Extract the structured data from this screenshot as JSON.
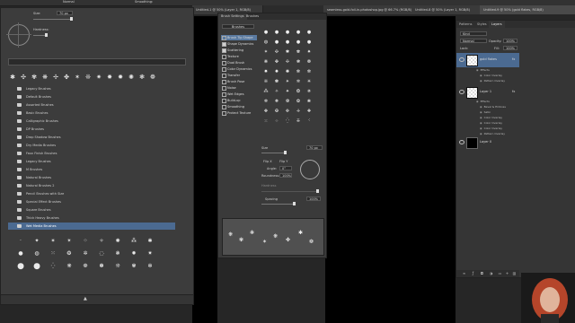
{
  "top_bar": {
    "mode_label": "Normal",
    "snapshot_label": "Smoothing:"
  },
  "document_tabs": [
    "Untitled-1 @ 50% (Layer 1, RGB/8)",
    "seamless-gold-foil-in-photoshop.jpg @ 66.7% (RGB/8)",
    "Untitled-8 @ 50% (Layer 1, RGB/8)",
    "Untitled-9 @ 50% (gold flakes, RGB/8)"
  ],
  "brush_preset_panel": {
    "size_label": "Size:",
    "size_value": "70 px",
    "hardness_label": "Hardness:",
    "folders": [
      "Legacy Brushes",
      "Default Brushes",
      "Assorted Brushes",
      "Basic Brushes",
      "Calligraphic Brushes",
      "DP Brushes",
      "Drop Shadow Brushes",
      "Dry Media Brushes",
      "Faux Finish Brushes",
      "Legacy Brushes",
      "M Brushes",
      "Natural Brushes",
      "Natural Brushes 2",
      "Pencil Brushes with Size",
      "Special Effect Brushes",
      "Square Brushes",
      "Thick Heavy Brushes",
      "Wet Media Brushes"
    ],
    "selected_folder_index": 17
  },
  "brush_settings_panel": {
    "tabs": [
      "Brush Settings",
      "Brushes"
    ],
    "brushes_button": "Brushes",
    "options": [
      {
        "label": "Brush Tip Shape",
        "on": false,
        "selected": true
      },
      {
        "label": "Shape Dynamics",
        "on": true,
        "selected": false
      },
      {
        "label": "Scattering",
        "on": true,
        "selected": false
      },
      {
        "label": "Texture",
        "on": false,
        "selected": false
      },
      {
        "label": "Dual Brush",
        "on": false,
        "selected": false
      },
      {
        "label": "Color Dynamics",
        "on": false,
        "selected": false
      },
      {
        "label": "Transfer",
        "on": false,
        "selected": false
      },
      {
        "label": "Brush Pose",
        "on": false,
        "selected": false
      },
      {
        "label": "Noise",
        "on": false,
        "selected": false
      },
      {
        "label": "Wet Edges",
        "on": false,
        "selected": false
      },
      {
        "label": "Build-up",
        "on": false,
        "selected": false
      },
      {
        "label": "Smoothing",
        "on": false,
        "selected": false
      },
      {
        "label": "Protect Texture",
        "on": false,
        "selected": false
      }
    ],
    "size_label": "Size",
    "size_value": "70 px",
    "flip_x": "Flip X",
    "flip_y": "Flip Y",
    "angle_label": "Angle:",
    "angle_value": "0°",
    "roundness_label": "Roundness:",
    "roundness_value": "100%",
    "hardness_label": "Hardness",
    "spacing_label": "Spacing",
    "spacing_value": "100%"
  },
  "layers_panel": {
    "tabs": [
      "Patterns",
      "Styles",
      "Layers"
    ],
    "kind_label": "Kind",
    "blend_mode": "Normal",
    "opacity_label": "Opacity:",
    "opacity_value": "100%",
    "lock_label": "Lock:",
    "fill_label": "Fill:",
    "fill_value": "100%",
    "layers": [
      {
        "name": "gold flakes",
        "fx": "fx",
        "effects_label": "Effects",
        "effects": [
          "Color Overlay",
          "Pattern Overlay"
        ],
        "selected": true
      },
      {
        "name": "Layer 1",
        "fx": "fx",
        "effects_label": "Effects",
        "effects": [
          "Bevel & Emboss",
          "Satin",
          "Color Overlay",
          "Color Overlay",
          "Color Overlay",
          "Pattern Overlay"
        ],
        "selected": false
      },
      {
        "name": "Layer 0",
        "fx": "",
        "effects_label": "",
        "effects": [],
        "selected": false
      }
    ]
  },
  "colors": {
    "accent_selected": "#4b6a91",
    "panel": "#3c3c3c",
    "canvas": "#000000"
  }
}
